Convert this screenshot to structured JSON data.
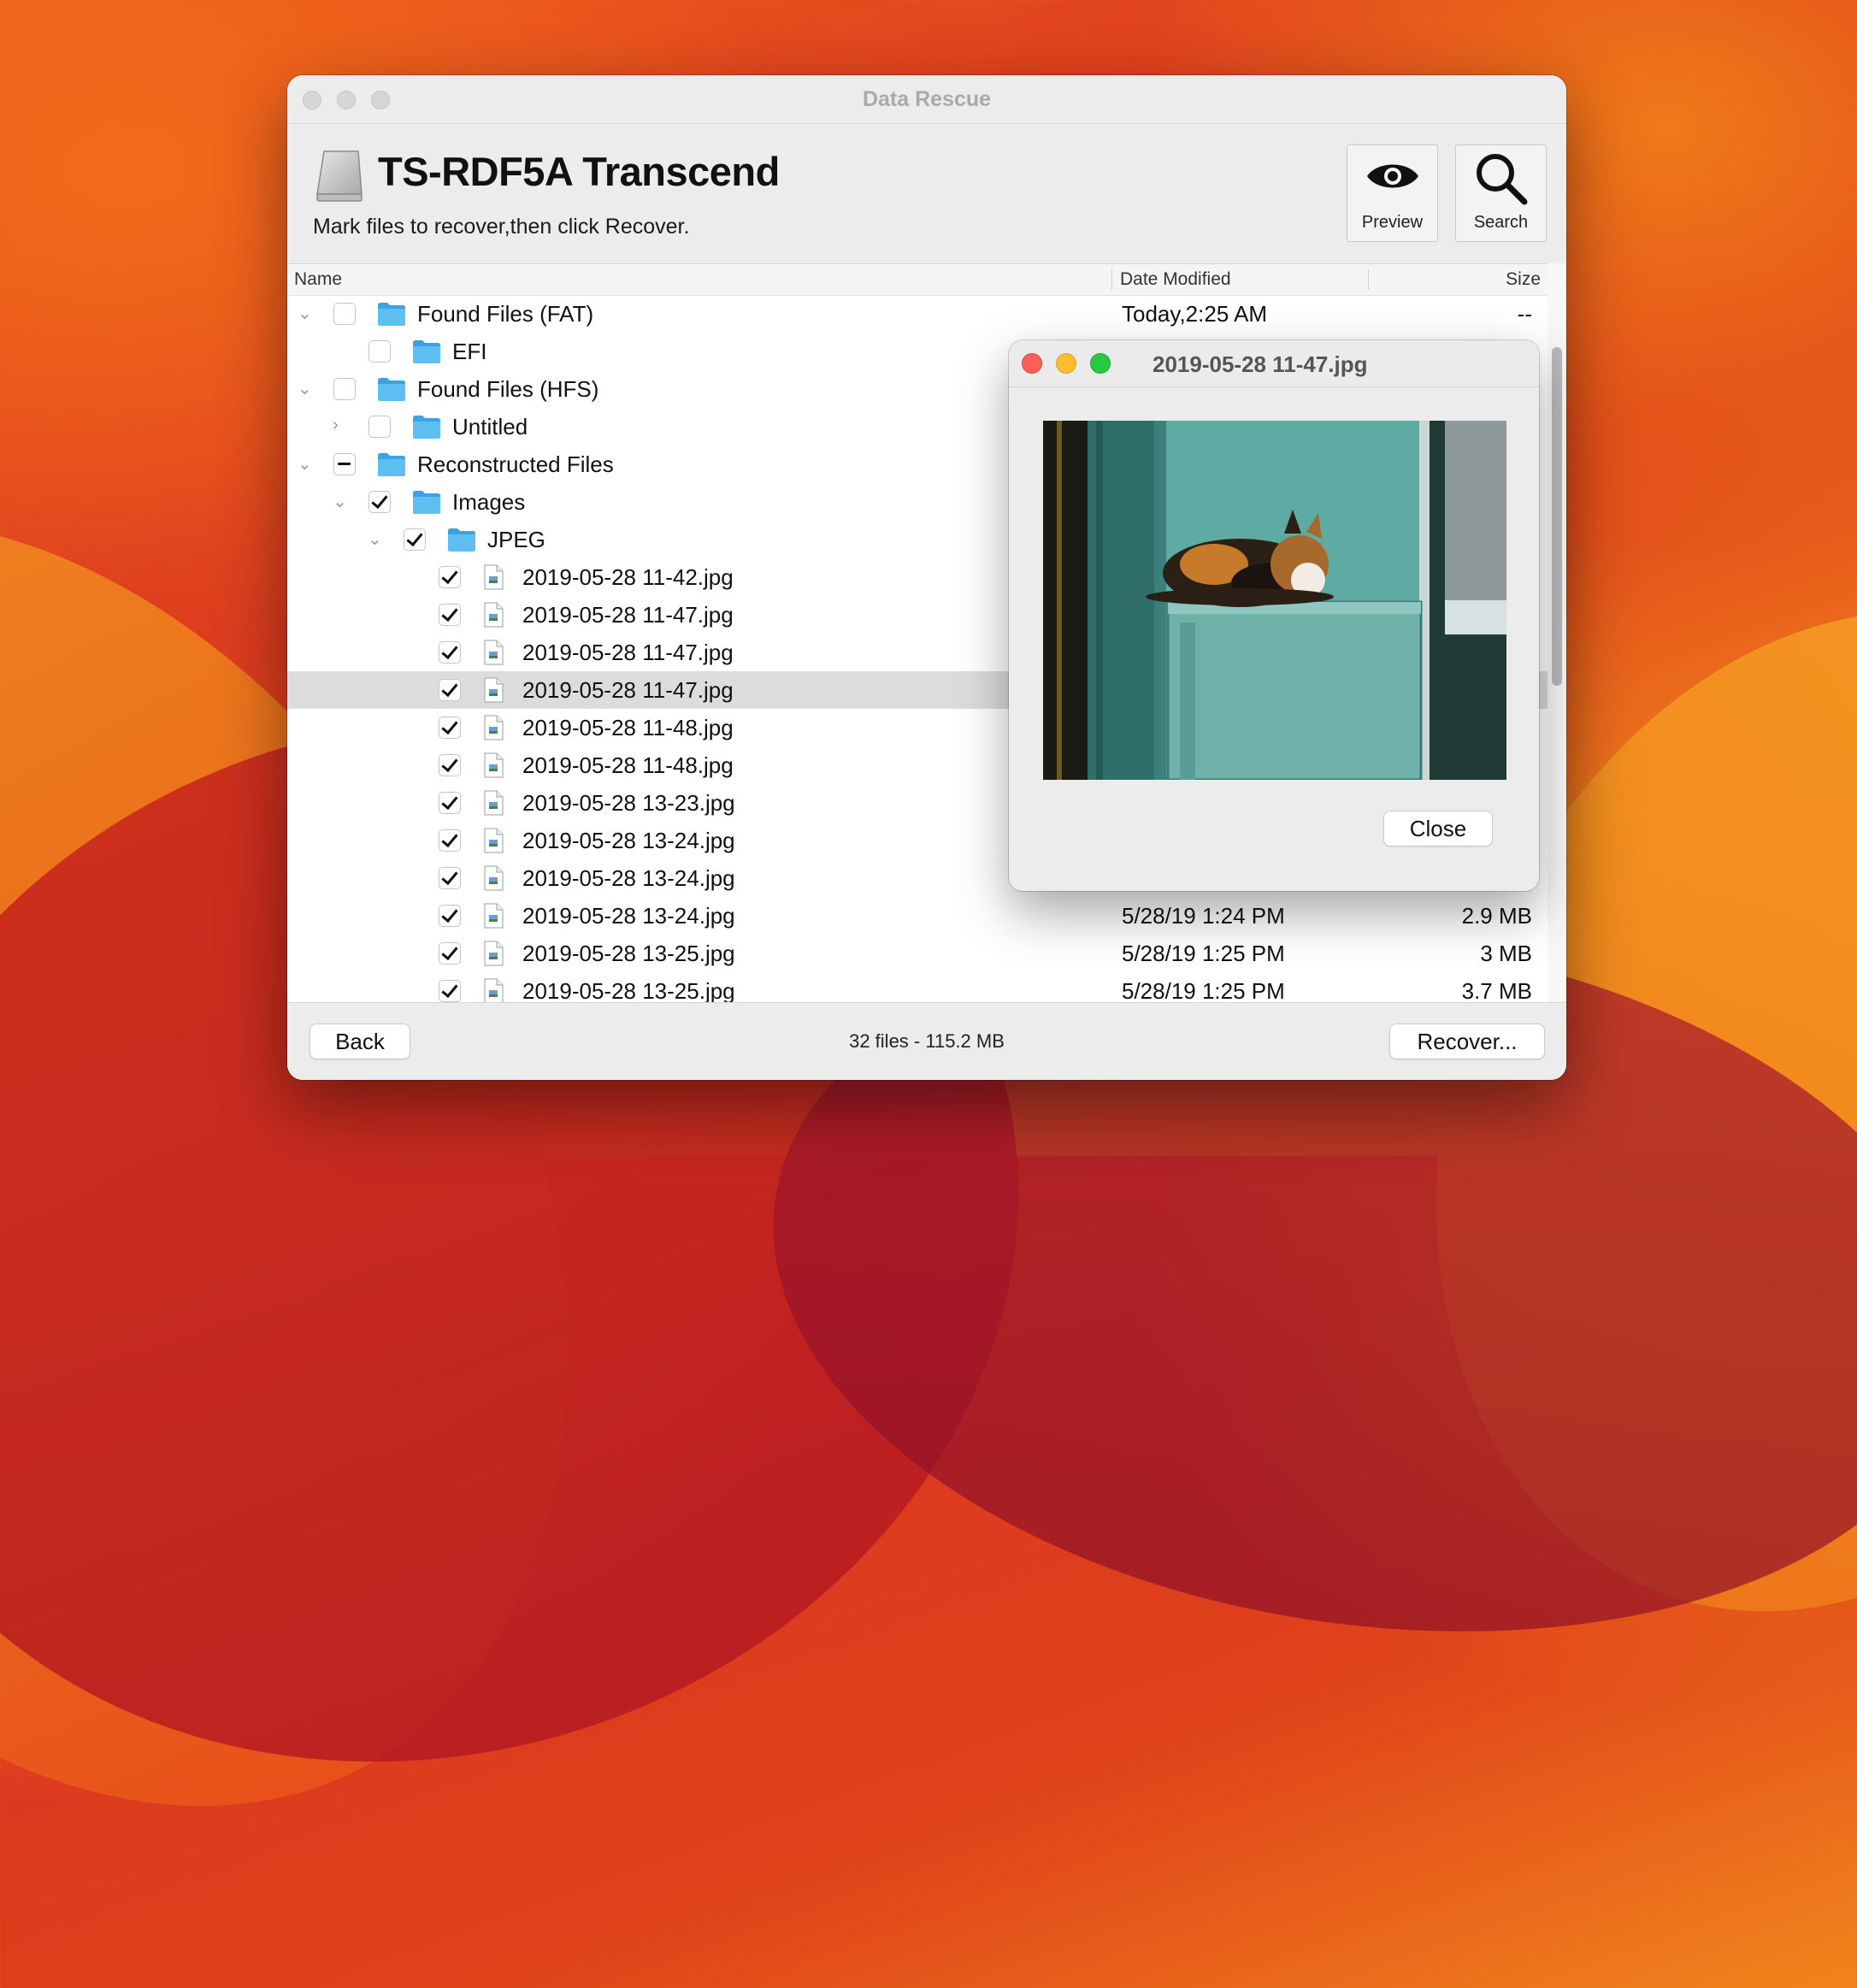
{
  "window": {
    "title": "Data Rescue"
  },
  "header": {
    "device_name": "TS-RDF5A Transcend",
    "instructions": "Mark files to recover,then click Recover.",
    "preview_label": "Preview",
    "search_label": "Search"
  },
  "columns": {
    "name": "Name",
    "date": "Date Modified",
    "size": "Size"
  },
  "rows": [
    {
      "name": "Found Files (FAT)",
      "date": "Today,2:25 AM",
      "size": "--"
    },
    {
      "name": "EFI",
      "date": "",
      "size": ""
    },
    {
      "name": "Found Files (HFS)",
      "date": "",
      "size": ""
    },
    {
      "name": "Untitled",
      "date": "",
      "size": ""
    },
    {
      "name": "Reconstructed Files",
      "date": "",
      "size": ""
    },
    {
      "name": "Images",
      "date": "",
      "size": ""
    },
    {
      "name": "JPEG",
      "date": "",
      "size": ""
    },
    {
      "name": "2019-05-28 11-42.jpg",
      "date": "",
      "size": ""
    },
    {
      "name": "2019-05-28 11-47.jpg",
      "date": "",
      "size": ""
    },
    {
      "name": "2019-05-28 11-47.jpg",
      "date": "",
      "size": ""
    },
    {
      "name": "2019-05-28 11-47.jpg",
      "date": "",
      "size": ""
    },
    {
      "name": "2019-05-28 11-48.jpg",
      "date": "",
      "size": ""
    },
    {
      "name": "2019-05-28 11-48.jpg",
      "date": "",
      "size": ""
    },
    {
      "name": "2019-05-28 13-23.jpg",
      "date": "",
      "size": ""
    },
    {
      "name": "2019-05-28 13-24.jpg",
      "date": "",
      "size": ""
    },
    {
      "name": "2019-05-28 13-24.jpg",
      "date": "",
      "size": ""
    },
    {
      "name": "2019-05-28 13-24.jpg",
      "date": "5/28/19 1:24 PM",
      "size": "2.9 MB"
    },
    {
      "name": "2019-05-28 13-25.jpg",
      "date": "5/28/19 1:25 PM",
      "size": "3 MB"
    },
    {
      "name": "2019-05-28 13-25.jpg",
      "date": "5/28/19 1:25 PM",
      "size": "3.7 MB"
    }
  ],
  "footer": {
    "back_label": "Back",
    "status": "32 files - 115.2 MB",
    "recover_label": "Recover..."
  },
  "preview_window": {
    "title": "2019-05-28 11-47.jpg",
    "close_label": "Close"
  },
  "icons": {
    "disk": "external-drive-icon",
    "folder": "folder-icon",
    "file": "jpeg-file-icon",
    "preview": "eye-icon",
    "search": "magnifier-icon"
  },
  "colors": {
    "folder": "#4fb4ec",
    "close": "#fe5f57",
    "minimize": "#febc2e",
    "zoom": "#28c840"
  }
}
